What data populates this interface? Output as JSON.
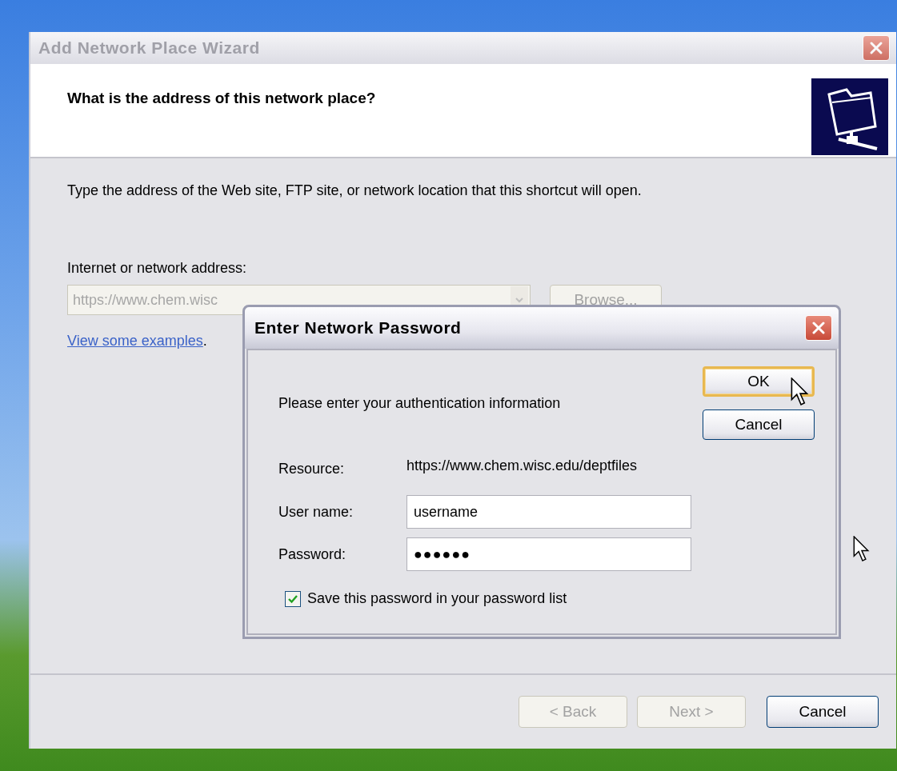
{
  "wizard": {
    "title": "Add Network Place Wizard",
    "heading": "What is the address of this network place?",
    "instruction": "Type the address of the Web site, FTP site, or network location that this shortcut will open.",
    "address_label": "Internet or network address:",
    "address_field": {
      "value": "https://www.chem.wisc",
      "disabled": true
    },
    "browse_button": {
      "label": "Browse...",
      "disabled": true
    },
    "examples": {
      "link": "View some examples",
      "suffix": "."
    },
    "buttons": [
      {
        "label": "< Back",
        "disabled": true
      },
      {
        "label": "Next >",
        "disabled": true
      },
      {
        "label": "Cancel",
        "disabled": false
      }
    ]
  },
  "password_dialog": {
    "title": "Enter Network Password",
    "prompt": "Please enter your authentication information",
    "buttons": [
      {
        "label": "OK",
        "focused": true
      },
      {
        "label": "Cancel",
        "focused": false
      }
    ],
    "resource_label": "Resource:",
    "resource": "https://www.chem.wisc.edu/deptfiles",
    "username_label": "User name:",
    "username": "username",
    "password_label": "Password:",
    "password": "●●●●●●",
    "save_password": {
      "label": "Save this password in your password list",
      "checked": true
    }
  }
}
